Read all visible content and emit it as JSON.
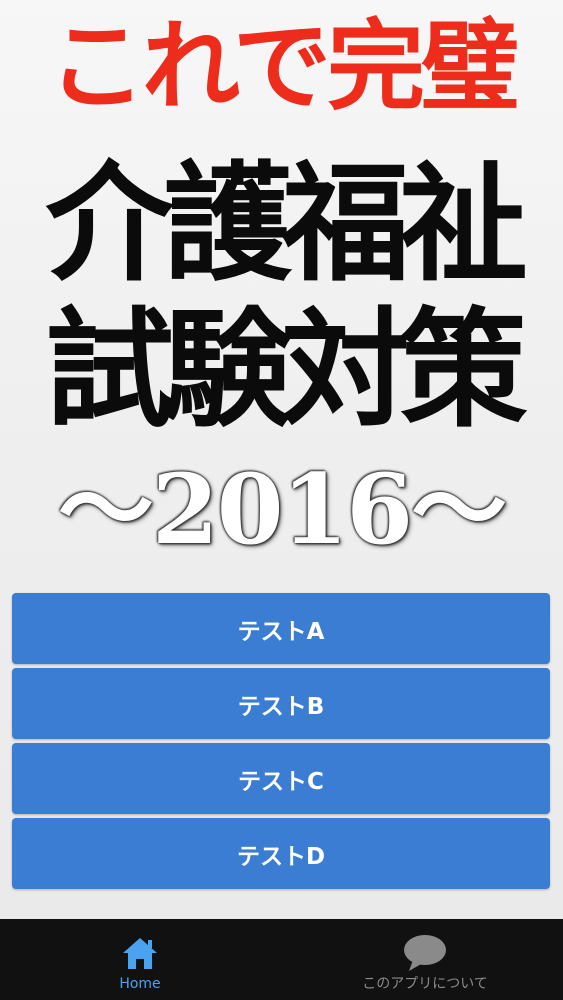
{
  "header": {
    "tagline": "これで完璧",
    "title_line1": "介護福祉",
    "title_line2": "試験対策",
    "year_banner": "〜2016〜"
  },
  "tests": [
    {
      "label": "テストA"
    },
    {
      "label": "テストB"
    },
    {
      "label": "テストC"
    },
    {
      "label": "テストD"
    }
  ],
  "tabbar": {
    "home": {
      "label": "Home",
      "icon": "home-icon",
      "active": true
    },
    "about": {
      "label": "このアプリについて",
      "icon": "speech-bubble-icon",
      "active": false
    }
  },
  "colors": {
    "tagline": "#ee2c1b",
    "button": "#3b7dd2",
    "tab_active": "#4aa3f0",
    "tab_inactive": "#8a8a8a",
    "tabbar_bg": "#111111"
  }
}
